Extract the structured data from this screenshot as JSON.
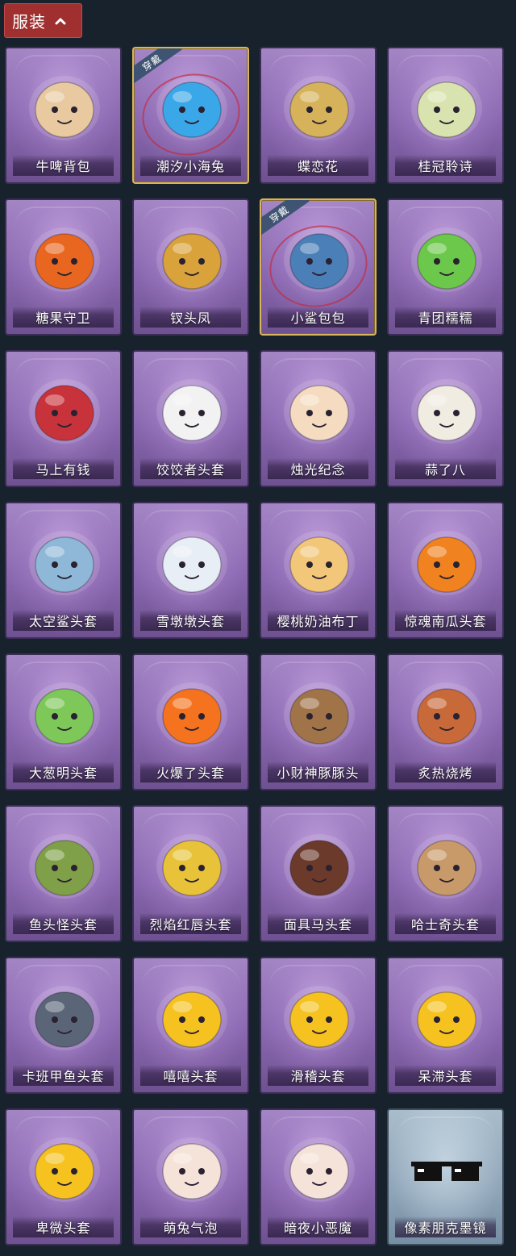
{
  "header": {
    "title": "服装",
    "chevron_icon": "chevron-up-icon",
    "bg_color": "#a02f2f"
  },
  "items": [
    {
      "label": "牛啤背包",
      "icon": "cow-beer-barrel-icon",
      "color": "#e8c9a0",
      "worn": false
    },
    {
      "label": "潮汐小海兔",
      "icon": "blue-sea-bunny-icon",
      "color": "#3aa8e8",
      "worn": true,
      "badge": "穿戴"
    },
    {
      "label": "蝶恋花",
      "icon": "butterfly-bell-wreath-icon",
      "color": "#d6b35a",
      "worn": false
    },
    {
      "label": "桂冠聆诗",
      "icon": "laurel-doll-charm-icon",
      "color": "#d9e3b0",
      "worn": false
    },
    {
      "label": "糖果守卫",
      "icon": "pumpkin-scarecrow-charm-icon",
      "color": "#e8661f",
      "worn": false
    },
    {
      "label": "钗头凤",
      "icon": "phoenix-crown-doll-icon",
      "color": "#d9a23a",
      "worn": false
    },
    {
      "label": "小鲨包包",
      "icon": "shark-bag-charm-icon",
      "color": "#4a7fb8",
      "worn": true,
      "badge": "穿戴"
    },
    {
      "label": "青团糯糯",
      "icon": "green-rice-ball-icon",
      "color": "#6cc84a",
      "worn": false
    },
    {
      "label": "马上有钱",
      "icon": "red-horse-head-icon",
      "color": "#c8323a",
      "worn": false
    },
    {
      "label": "饺饺者头套",
      "icon": "dumpling-head-icon",
      "color": "#f2f2f2",
      "worn": false
    },
    {
      "label": "烛光纪念",
      "icon": "candle-head-icon",
      "color": "#f5dcc0",
      "worn": false
    },
    {
      "label": "蒜了八",
      "icon": "garlic-head-icon",
      "color": "#f0ece2",
      "worn": false
    },
    {
      "label": "太空鲨头套",
      "icon": "space-shark-head-icon",
      "color": "#8fb8d8",
      "worn": false
    },
    {
      "label": "雪墩墩头套",
      "icon": "snowman-head-icon",
      "color": "#e8eef5",
      "worn": false
    },
    {
      "label": "樱桃奶油布丁",
      "icon": "pudding-head-icon",
      "color": "#f2c77a",
      "worn": false
    },
    {
      "label": "惊魂南瓜头套",
      "icon": "pumpkin-head-icon",
      "color": "#f0821f",
      "worn": false
    },
    {
      "label": "大葱明头套",
      "icon": "scallion-head-icon",
      "color": "#7ec85a",
      "worn": false
    },
    {
      "label": "火爆了头套",
      "icon": "fireball-head-icon",
      "color": "#f5731f",
      "worn": false
    },
    {
      "label": "小财神豚豚头",
      "icon": "capybara-god-head-icon",
      "color": "#a07448",
      "worn": false
    },
    {
      "label": "炙热烧烤",
      "icon": "bbq-meat-head-icon",
      "color": "#c8693a",
      "worn": false
    },
    {
      "label": "鱼头怪头套",
      "icon": "fish-monster-head-icon",
      "color": "#7fa048",
      "worn": false
    },
    {
      "label": "烈焰红唇头套",
      "icon": "yellow-mouse-head-icon",
      "color": "#e8c33a",
      "worn": false
    },
    {
      "label": "面具马头套",
      "icon": "horse-mask-head-icon",
      "color": "#6b3a2a",
      "worn": false
    },
    {
      "label": "哈士奇头套",
      "icon": "husky-head-icon",
      "color": "#c89a6a",
      "worn": false
    },
    {
      "label": "卡班甲鱼头套",
      "icon": "whale-head-icon",
      "color": "#5a6578",
      "worn": false
    },
    {
      "label": "嘻嘻头套",
      "icon": "grin-emoji-head-icon",
      "color": "#f5c21f",
      "worn": false
    },
    {
      "label": "滑稽头套",
      "icon": "smirk-emoji-head-icon",
      "color": "#f5c21f",
      "worn": false
    },
    {
      "label": "呆滞头套",
      "icon": "dazed-emoji-head-icon",
      "color": "#f5c21f",
      "worn": false
    },
    {
      "label": "卑微头套",
      "icon": "humble-emoji-head-icon",
      "color": "#f5c21f",
      "worn": false
    },
    {
      "label": "萌兔气泡",
      "icon": "bunny-bubble-head-icon",
      "color": "#f5e2d8",
      "worn": false
    },
    {
      "label": "暗夜小恶魔",
      "icon": "little-devil-head-icon",
      "color": "#f5e2d8",
      "worn": false
    },
    {
      "label": "像素朋克墨镜",
      "icon": "pixel-sunglasses-icon",
      "color": "#111111",
      "worn": false,
      "special": true
    }
  ]
}
